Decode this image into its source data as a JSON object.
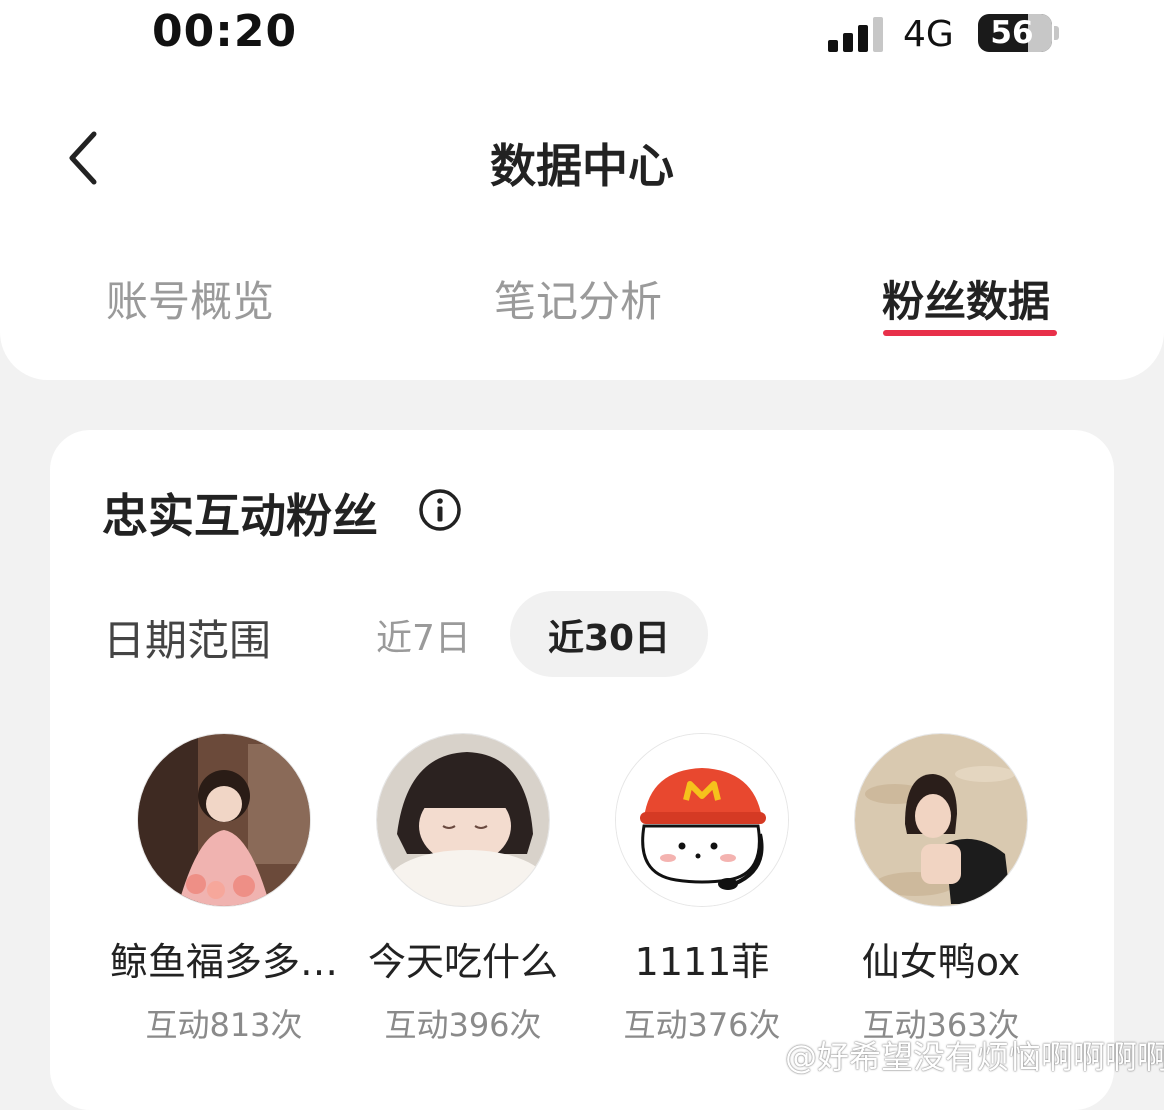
{
  "status_bar": {
    "time": "00:20",
    "network": "4G",
    "battery": "56"
  },
  "header": {
    "title": "数据中心"
  },
  "tabs": [
    {
      "label": "账号概览",
      "active": false
    },
    {
      "label": "笔记分析",
      "active": false
    },
    {
      "label": "粉丝数据",
      "active": true
    }
  ],
  "section": {
    "title": "忠实互动粉丝",
    "date_range": {
      "label": "日期范围",
      "options": [
        {
          "label": "近7日",
          "selected": false
        },
        {
          "label": "近30日",
          "selected": true
        }
      ]
    },
    "fans": [
      {
        "name": "鲸鱼福多多…",
        "count": "互动813次"
      },
      {
        "name": "今天吃什么",
        "count": "互动396次"
      },
      {
        "name": "1111菲",
        "count": "互动376次"
      },
      {
        "name": "仙女鸭ox",
        "count": "互动363次"
      }
    ]
  },
  "watermark": "@好希望没有烦恼啊啊啊啊",
  "colors": {
    "accent": "#e8304a",
    "background": "#f2f2f2",
    "card": "#ffffff"
  }
}
